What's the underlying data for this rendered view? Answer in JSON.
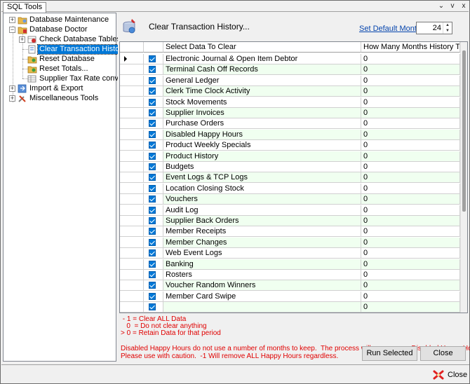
{
  "tab": {
    "label": "SQL Tools",
    "controls": [
      "⌄",
      "v",
      "x"
    ]
  },
  "tree": {
    "items": [
      {
        "label": "Database Maintenance",
        "expander": "+",
        "icon": "folder-icon"
      },
      {
        "label": "Database Doctor",
        "expander": "−",
        "icon": "doctor-icon"
      },
      {
        "label": "Check Database Tables",
        "expander": "+",
        "icon": "table-check-icon"
      },
      {
        "label": "Clear Transaction History...",
        "expander": "",
        "icon": "clear-history-icon",
        "selected": true
      },
      {
        "label": "Reset Database",
        "expander": "",
        "icon": "reset-db-icon"
      },
      {
        "label": "Reset Totals...",
        "expander": "",
        "icon": "reset-totals-icon"
      },
      {
        "label": "Supplier Tax Rate conversion",
        "expander": "",
        "icon": "tax-rate-icon"
      },
      {
        "label": "Import & Export",
        "expander": "+",
        "icon": "import-export-icon"
      },
      {
        "label": "Miscellaneous Tools",
        "expander": "+",
        "icon": "tools-icon"
      }
    ]
  },
  "main": {
    "title": "Clear Transaction History...",
    "set_default_label": "Set Default Months:",
    "default_months": "24",
    "columns": [
      "Select Data To Clear",
      "How Many Months History To Keep"
    ],
    "rows": [
      {
        "name": "Electronic Journal & Open Item Debtor",
        "months": "0",
        "checked": true,
        "current": true
      },
      {
        "name": "Terminal Cash Off Records",
        "months": "0",
        "checked": true
      },
      {
        "name": "General Ledger",
        "months": "0",
        "checked": true
      },
      {
        "name": "Clerk Time Clock Activity",
        "months": "0",
        "checked": true
      },
      {
        "name": "Stock Movements",
        "months": "0",
        "checked": true
      },
      {
        "name": "Supplier Invoices",
        "months": "0",
        "checked": true
      },
      {
        "name": "Purchase Orders",
        "months": "0",
        "checked": true
      },
      {
        "name": "Disabled Happy Hours",
        "months": "0",
        "checked": true
      },
      {
        "name": "Product Weekly Specials",
        "months": "0",
        "checked": true
      },
      {
        "name": "Product History",
        "months": "0",
        "checked": true
      },
      {
        "name": "Budgets",
        "months": "0",
        "checked": true
      },
      {
        "name": "Event Logs & TCP Logs",
        "months": "0",
        "checked": true
      },
      {
        "name": "Location Closing Stock",
        "months": "0",
        "checked": true
      },
      {
        "name": "Vouchers",
        "months": "0",
        "checked": true
      },
      {
        "name": "Audit Log",
        "months": "0",
        "checked": true
      },
      {
        "name": "Supplier Back Orders",
        "months": "0",
        "checked": true
      },
      {
        "name": "Member Receipts",
        "months": "0",
        "checked": true
      },
      {
        "name": "Member Changes",
        "months": "0",
        "checked": true
      },
      {
        "name": "Web Event Logs",
        "months": "0",
        "checked": true
      },
      {
        "name": "Banking",
        "months": "0",
        "checked": true
      },
      {
        "name": "Rosters",
        "months": "0",
        "checked": true
      },
      {
        "name": "Voucher Random Winners",
        "months": "0",
        "checked": true
      },
      {
        "name": "Member Card Swipe",
        "months": "0",
        "checked": true
      },
      {
        "name": "",
        "months": "0",
        "checked": true
      }
    ],
    "notes": " - 1 = Clear ALL Data\n   0  = Do not clear anything\n> 0 = Retain Data for that period",
    "warning": "Disabled Happy Hours do not use a number of months to keep.  The process will remove any Disabled Happy Hours.\nPlease use with caution.  -1 Will remove ALL Happy Hours regardless.",
    "run_label": "Run Selected",
    "close_label": "Close"
  },
  "footer": {
    "close_label": "Close"
  },
  "colors": {
    "selection": "#0078d7",
    "note_red": "#e00000",
    "alt_row": "#f0fff0",
    "link": "#0645ad"
  }
}
